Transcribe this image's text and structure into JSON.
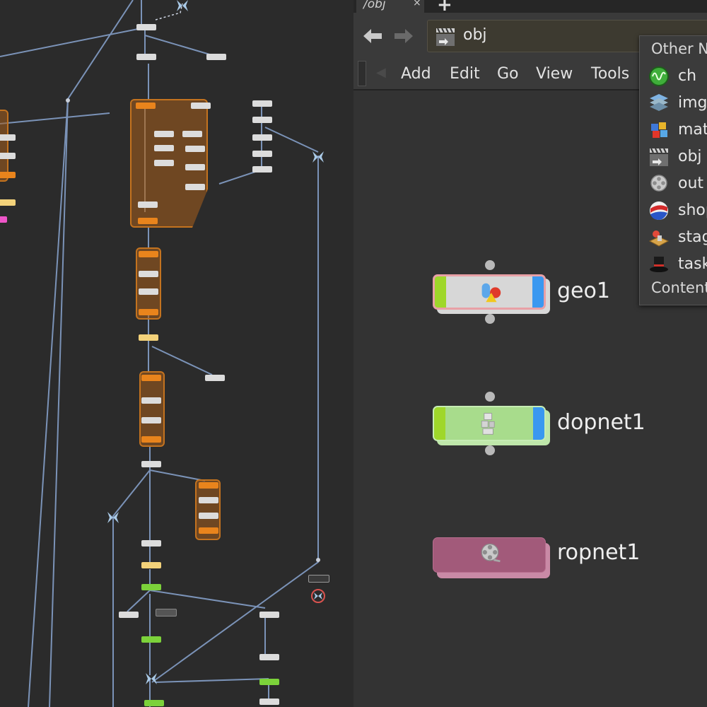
{
  "tab": {
    "title": "/obj",
    "close": "×",
    "add": "+"
  },
  "path": {
    "value": "obj"
  },
  "menu": {
    "items": [
      "Add",
      "Edit",
      "Go",
      "View",
      "Tools"
    ]
  },
  "context_menu": {
    "header": "Other N",
    "items": [
      {
        "label": "ch",
        "icon": "chop-network-icon"
      },
      {
        "label": "img",
        "icon": "image-network-icon"
      },
      {
        "label": "mat",
        "icon": "material-network-icon"
      },
      {
        "label": "obj",
        "icon": "object-network-icon"
      },
      {
        "label": "out",
        "icon": "output-network-icon"
      },
      {
        "label": "shop",
        "icon": "shader-network-icon"
      },
      {
        "label": "stag",
        "icon": "stage-network-icon"
      },
      {
        "label": "task",
        "icon": "task-network-icon"
      }
    ],
    "footer": "Content"
  },
  "nodes": {
    "geo1": "geo1",
    "dopnet1": "dopnet1",
    "ropnet1": "ropnet1"
  },
  "colors": {
    "geo_body": "#d7d7d7",
    "dop_body": "#a8dc8c",
    "rop_body": "#a25a7a",
    "flag_green": "#9fd72a",
    "flag_blue": "#3a98f0",
    "wire": "#7b93b8",
    "orange_block": "#c4731f"
  }
}
